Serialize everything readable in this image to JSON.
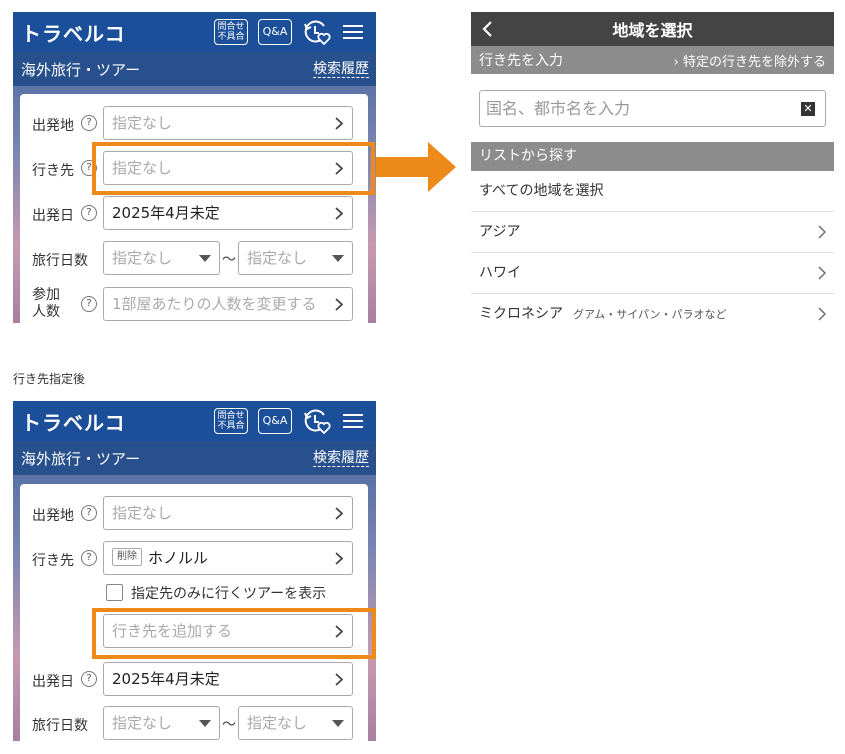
{
  "top_panel": {
    "app": {
      "logo": "トラベルコ",
      "inquiry_icon_line1": "問合せ",
      "inquiry_icon_line2": "不具合",
      "qa_label": "Q&A",
      "subtitle": "海外旅行・ツアー",
      "history_link": "検索履歴"
    },
    "form": {
      "departure_label": "出発地",
      "departure_value": "指定なし",
      "destination_label": "行き先",
      "destination_value": "指定なし",
      "date_label": "出発日",
      "date_value": "2025年4月未定",
      "days_label": "旅行日数",
      "days_from": "指定なし",
      "days_sep": "～",
      "days_to": "指定なし",
      "people_label_line1": "参加",
      "people_label_line2": "人数",
      "people_value": "1部屋あたりの人数を変更する"
    }
  },
  "region_panel": {
    "title": "地域を選択",
    "input_header": "行き先を入力",
    "exclude_link": "特定の行き先を除外する",
    "search_placeholder": "国名、都市名を入力",
    "list_header": "リストから探す",
    "items": [
      {
        "label": "すべての地域を選択",
        "note": ""
      },
      {
        "label": "アジア",
        "note": ""
      },
      {
        "label": "ハワイ",
        "note": ""
      },
      {
        "label": "ミクロネシア",
        "note": "グアム・サイパン・パラオなど"
      }
    ]
  },
  "caption": "行き先指定後",
  "bottom_panel": {
    "app": {
      "logo": "トラベルコ",
      "inquiry_icon_line1": "問合せ",
      "inquiry_icon_line2": "不具合",
      "qa_label": "Q&A",
      "subtitle": "海外旅行・ツアー",
      "history_link": "検索履歴"
    },
    "form": {
      "departure_label": "出発地",
      "departure_value": "指定なし",
      "destination_label": "行き先",
      "delete_label": "削除",
      "destination_value": "ホノルル",
      "only_checkbox_label": "指定先のみに行くツアーを表示",
      "add_destination_placeholder": "行き先を追加する",
      "date_label": "出発日",
      "date_value": "2025年4月未定",
      "days_label": "旅行日数",
      "days_from": "指定なし",
      "days_sep": "～",
      "days_to": "指定なし"
    }
  },
  "colors": {
    "header_blue": "#1c4f99",
    "highlight_orange": "#ee8a1a",
    "region_header": "#444444",
    "region_subheader": "#8c8c8c"
  }
}
